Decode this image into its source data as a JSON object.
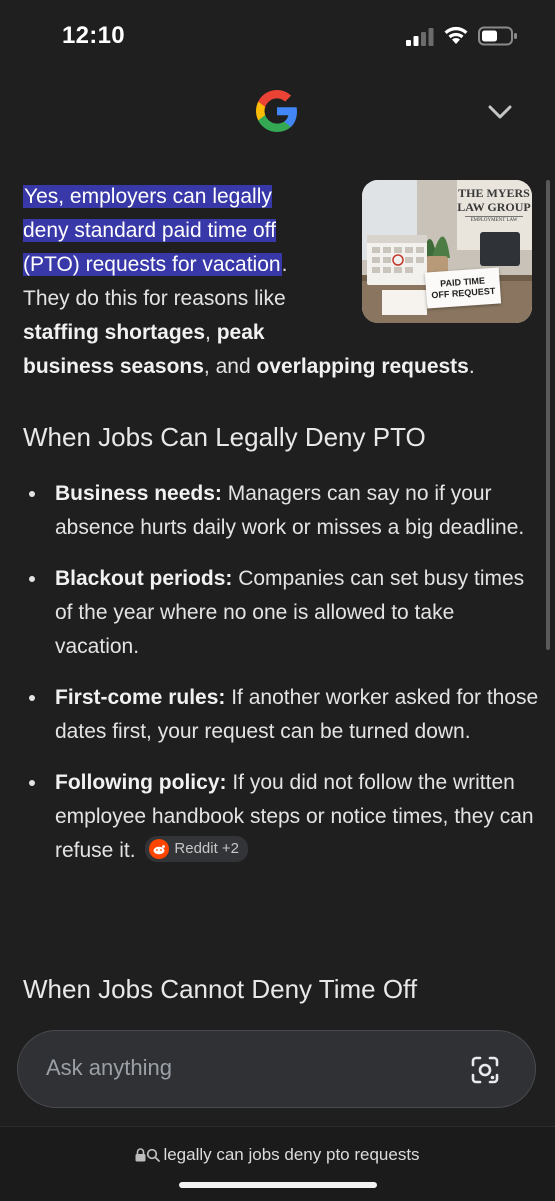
{
  "status_bar": {
    "time": "12:10"
  },
  "answer": {
    "intro_highlight_1": "Yes, employers can legally",
    "intro_highlight_2": "deny standard paid time off",
    "intro_highlight_3": "(PTO) requests for vacation",
    "intro_rest_1": ".",
    "intro_rest_2": "They do this for reasons like",
    "bold_1": "staffing shortages",
    "sep_1": ", ",
    "bold_2a": "peak",
    "bold_2b": "business seasons",
    "sep_2": ", and ",
    "bold_3": "overlapping requests",
    "end": "."
  },
  "thumbnail": {
    "sign_line1": "THE MYERS",
    "sign_line2": "LAW GROUP",
    "sign_line3": "EMPLOYMENT LAW",
    "card_line1": "PAID TIME",
    "card_line2": "OFF REQUEST"
  },
  "section_deny": {
    "heading": "When Jobs Can Legally Deny PTO",
    "bullets": [
      {
        "title": "Business needs:",
        "text": " Managers can say no if your absence hurts daily work or misses a big deadline."
      },
      {
        "title": "Blackout periods:",
        "text": " Companies can set busy times of the year where no one is allowed to take vacation."
      },
      {
        "title": "First-come rules:",
        "text": " If another worker asked for those dates first, your request can be turned down."
      },
      {
        "title": "Following policy:",
        "text": " If you did not follow the written employee handbook steps or notice times, they can refuse it."
      }
    ],
    "source_chip": "Reddit +2"
  },
  "section_cannot": {
    "heading": "When Jobs Cannot Deny Time Off"
  },
  "ask": {
    "placeholder": "Ask anything"
  },
  "url_bar": {
    "query": "legally can jobs deny pto requests"
  },
  "icons": {
    "collapse": "chevron-down-icon",
    "lens": "lens-camera-icon",
    "lock": "lock-icon",
    "search": "search-icon",
    "reddit": "reddit-icon"
  },
  "colors": {
    "background": "#1f1f1f",
    "highlight": "#3838a8",
    "ask_bar": "#303134"
  }
}
